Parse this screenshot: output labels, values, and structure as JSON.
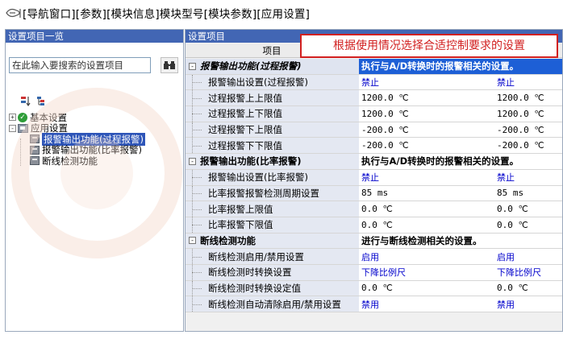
{
  "breadcrumb": {
    "text": "[导航窗口][参数][模块信息]模块型号[模块参数][应用设置]"
  },
  "left_panel": {
    "title": "设置项目一览",
    "search_placeholder": "在此输入要搜索的设置项目",
    "tree": [
      {
        "label": "基本设置",
        "expander": "+"
      },
      {
        "label": "应用设置",
        "expander": "-"
      },
      {
        "label": "报警输出功能(过程报警)",
        "selected": true
      },
      {
        "label": "报警输出功能(比率报警)"
      },
      {
        "label": "断线检测功能"
      }
    ]
  },
  "right_panel": {
    "title": "设置项目",
    "col_item": "项目",
    "callout": "根据使用情况选择合适控制要求的设置",
    "categories": [
      {
        "label": "报警输出功能(过程报警)",
        "desc": "执行与A/D转换时的报警相关的设置。",
        "params": [
          {
            "name": "报警输出设置(过程报警)",
            "v1": "禁止",
            "v2": "禁止"
          },
          {
            "name": "过程报警上上限值",
            "v1": "1200.0 ℃",
            "v2": "1200.0 ℃"
          },
          {
            "name": "过程报警上下限值",
            "v1": "1200.0 ℃",
            "v2": "1200.0 ℃"
          },
          {
            "name": "过程报警下上限值",
            "v1": "-200.0 ℃",
            "v2": "-200.0 ℃"
          },
          {
            "name": "过程报警下下限值",
            "v1": "-200.0 ℃",
            "v2": "-200.0 ℃"
          }
        ]
      },
      {
        "label": "报警输出功能(比率报警)",
        "desc": "执行与A/D转换时的报警相关的设置。",
        "params": [
          {
            "name": "报警输出设置(比率报警)",
            "v1": "禁止",
            "v2": "禁止"
          },
          {
            "name": "比率报警报警检测周期设置",
            "v1": "85 ms",
            "v2": "85 ms"
          },
          {
            "name": "比率报警上限值",
            "v1": "0.0 ℃",
            "v2": "0.0 ℃"
          },
          {
            "name": "比率报警下限值",
            "v1": "0.0 ℃",
            "v2": "0.0 ℃"
          }
        ]
      },
      {
        "label": "断线检测功能",
        "desc": "进行与断线检测相关的设置。",
        "params": [
          {
            "name": "断线检测启用/禁用设置",
            "v1": "启用",
            "v2": "启用"
          },
          {
            "name": "断线检测时转换设置",
            "v1": "下降比例尺",
            "v2": "下降比例尺"
          },
          {
            "name": "断线检测时转换设定值",
            "v1": "0.0 ℃",
            "v2": "0.0 ℃"
          },
          {
            "name": "断线检测自动清除启用/禁用设置",
            "v1": "禁用",
            "v2": "禁用"
          }
        ]
      }
    ]
  },
  "colors": {
    "header_blue": "#4266b4",
    "selected_blue": "#1d5fd6",
    "callout_red": "#d22020",
    "value_blue": "#0000cc"
  }
}
